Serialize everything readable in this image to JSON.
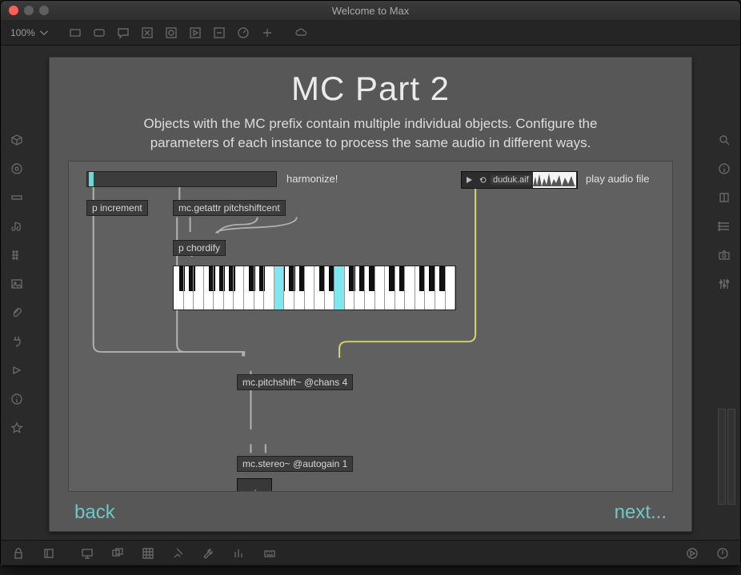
{
  "window": {
    "title": "Welcome to Max"
  },
  "toolbar": {
    "zoom": "100%"
  },
  "page": {
    "heading": "MC Part 2",
    "subtitle": "Objects with the MC prefix contain multiple individual objects. Configure the parameters of each instance to process the same audio in different ways."
  },
  "labels": {
    "harmonize": "harmonize!",
    "play_audio": "play audio file"
  },
  "objects": {
    "p_increment": "p increment",
    "mc_getattr": "mc.getattr pitchshiftcent",
    "p_chordify": "p chordify",
    "mc_pitchshift": "mc.pitchshift~ @chans 4",
    "mc_stereo": "mc.stereo~ @autogain 1"
  },
  "audio": {
    "filename": "duduk.aif"
  },
  "nav": {
    "back": "back",
    "next": "next..."
  },
  "keyboard": {
    "white_keys": 28,
    "highlighted_white": [
      10,
      16
    ],
    "black_positions_pct": [
      1.95,
      5.5,
      12.6,
      16.15,
      19.7,
      26.8,
      30.35,
      37.45,
      41.0,
      44.55,
      51.65,
      55.2,
      62.3,
      65.85,
      69.4,
      76.5,
      80.05,
      87.15,
      90.7,
      94.25
    ],
    "black_width_pct": 2.1
  }
}
